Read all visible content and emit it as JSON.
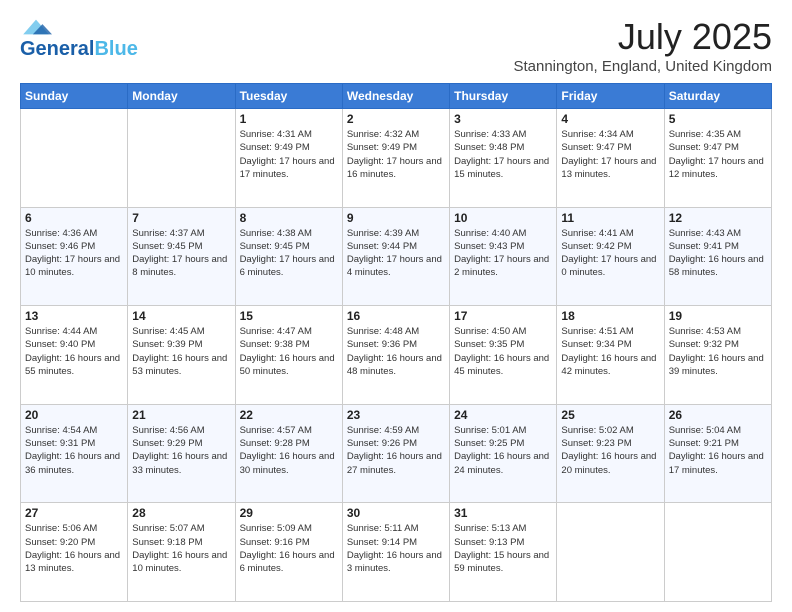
{
  "header": {
    "logo": {
      "line1": "General",
      "line2": "Blue"
    },
    "title": "July 2025",
    "subtitle": "Stannington, England, United Kingdom"
  },
  "days_of_week": [
    "Sunday",
    "Monday",
    "Tuesday",
    "Wednesday",
    "Thursday",
    "Friday",
    "Saturday"
  ],
  "weeks": [
    [
      {
        "day": "",
        "info": ""
      },
      {
        "day": "",
        "info": ""
      },
      {
        "day": "1",
        "info": "Sunrise: 4:31 AM\nSunset: 9:49 PM\nDaylight: 17 hours and 17 minutes."
      },
      {
        "day": "2",
        "info": "Sunrise: 4:32 AM\nSunset: 9:49 PM\nDaylight: 17 hours and 16 minutes."
      },
      {
        "day": "3",
        "info": "Sunrise: 4:33 AM\nSunset: 9:48 PM\nDaylight: 17 hours and 15 minutes."
      },
      {
        "day": "4",
        "info": "Sunrise: 4:34 AM\nSunset: 9:47 PM\nDaylight: 17 hours and 13 minutes."
      },
      {
        "day": "5",
        "info": "Sunrise: 4:35 AM\nSunset: 9:47 PM\nDaylight: 17 hours and 12 minutes."
      }
    ],
    [
      {
        "day": "6",
        "info": "Sunrise: 4:36 AM\nSunset: 9:46 PM\nDaylight: 17 hours and 10 minutes."
      },
      {
        "day": "7",
        "info": "Sunrise: 4:37 AM\nSunset: 9:45 PM\nDaylight: 17 hours and 8 minutes."
      },
      {
        "day": "8",
        "info": "Sunrise: 4:38 AM\nSunset: 9:45 PM\nDaylight: 17 hours and 6 minutes."
      },
      {
        "day": "9",
        "info": "Sunrise: 4:39 AM\nSunset: 9:44 PM\nDaylight: 17 hours and 4 minutes."
      },
      {
        "day": "10",
        "info": "Sunrise: 4:40 AM\nSunset: 9:43 PM\nDaylight: 17 hours and 2 minutes."
      },
      {
        "day": "11",
        "info": "Sunrise: 4:41 AM\nSunset: 9:42 PM\nDaylight: 17 hours and 0 minutes."
      },
      {
        "day": "12",
        "info": "Sunrise: 4:43 AM\nSunset: 9:41 PM\nDaylight: 16 hours and 58 minutes."
      }
    ],
    [
      {
        "day": "13",
        "info": "Sunrise: 4:44 AM\nSunset: 9:40 PM\nDaylight: 16 hours and 55 minutes."
      },
      {
        "day": "14",
        "info": "Sunrise: 4:45 AM\nSunset: 9:39 PM\nDaylight: 16 hours and 53 minutes."
      },
      {
        "day": "15",
        "info": "Sunrise: 4:47 AM\nSunset: 9:38 PM\nDaylight: 16 hours and 50 minutes."
      },
      {
        "day": "16",
        "info": "Sunrise: 4:48 AM\nSunset: 9:36 PM\nDaylight: 16 hours and 48 minutes."
      },
      {
        "day": "17",
        "info": "Sunrise: 4:50 AM\nSunset: 9:35 PM\nDaylight: 16 hours and 45 minutes."
      },
      {
        "day": "18",
        "info": "Sunrise: 4:51 AM\nSunset: 9:34 PM\nDaylight: 16 hours and 42 minutes."
      },
      {
        "day": "19",
        "info": "Sunrise: 4:53 AM\nSunset: 9:32 PM\nDaylight: 16 hours and 39 minutes."
      }
    ],
    [
      {
        "day": "20",
        "info": "Sunrise: 4:54 AM\nSunset: 9:31 PM\nDaylight: 16 hours and 36 minutes."
      },
      {
        "day": "21",
        "info": "Sunrise: 4:56 AM\nSunset: 9:29 PM\nDaylight: 16 hours and 33 minutes."
      },
      {
        "day": "22",
        "info": "Sunrise: 4:57 AM\nSunset: 9:28 PM\nDaylight: 16 hours and 30 minutes."
      },
      {
        "day": "23",
        "info": "Sunrise: 4:59 AM\nSunset: 9:26 PM\nDaylight: 16 hours and 27 minutes."
      },
      {
        "day": "24",
        "info": "Sunrise: 5:01 AM\nSunset: 9:25 PM\nDaylight: 16 hours and 24 minutes."
      },
      {
        "day": "25",
        "info": "Sunrise: 5:02 AM\nSunset: 9:23 PM\nDaylight: 16 hours and 20 minutes."
      },
      {
        "day": "26",
        "info": "Sunrise: 5:04 AM\nSunset: 9:21 PM\nDaylight: 16 hours and 17 minutes."
      }
    ],
    [
      {
        "day": "27",
        "info": "Sunrise: 5:06 AM\nSunset: 9:20 PM\nDaylight: 16 hours and 13 minutes."
      },
      {
        "day": "28",
        "info": "Sunrise: 5:07 AM\nSunset: 9:18 PM\nDaylight: 16 hours and 10 minutes."
      },
      {
        "day": "29",
        "info": "Sunrise: 5:09 AM\nSunset: 9:16 PM\nDaylight: 16 hours and 6 minutes."
      },
      {
        "day": "30",
        "info": "Sunrise: 5:11 AM\nSunset: 9:14 PM\nDaylight: 16 hours and 3 minutes."
      },
      {
        "day": "31",
        "info": "Sunrise: 5:13 AM\nSunset: 9:13 PM\nDaylight: 15 hours and 59 minutes."
      },
      {
        "day": "",
        "info": ""
      },
      {
        "day": "",
        "info": ""
      }
    ]
  ]
}
